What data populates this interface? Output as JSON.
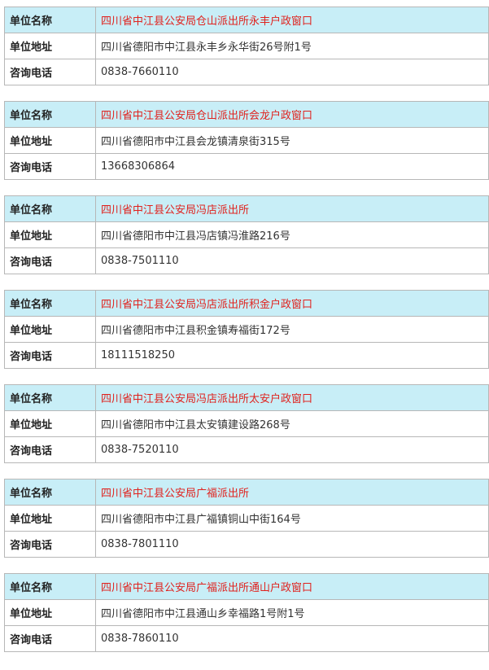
{
  "labels": {
    "name": "单位名称",
    "address": "单位地址",
    "phone": "咨询电话"
  },
  "colors": {
    "header_background": "#c8eef7",
    "name_text": "#e0221e",
    "border": "#b7b7b7"
  },
  "entries": [
    {
      "name": "四川省中江县公安局仓山派出所永丰户政窗口",
      "address": "四川省德阳市中江县永丰乡永华街26号附1号",
      "phone": "0838-7660110"
    },
    {
      "name": "四川省中江县公安局仓山派出所会龙户政窗口",
      "address": "四川省德阳市中江县会龙镇清泉街315号",
      "phone": "13668306864"
    },
    {
      "name": "四川省中江县公安局冯店派出所",
      "address": "四川省德阳市中江县冯店镇冯淮路216号",
      "phone": "0838-7501110"
    },
    {
      "name": "四川省中江县公安局冯店派出所积金户政窗口",
      "address": "四川省德阳市中江县积金镇寿福街172号",
      "phone": "18111518250"
    },
    {
      "name": "四川省中江县公安局冯店派出所太安户政窗口",
      "address": "四川省德阳市中江县太安镇建设路268号",
      "phone": "0838-7520110"
    },
    {
      "name": "四川省中江县公安局广福派出所",
      "address": "四川省德阳市中江县广福镇铜山中街164号",
      "phone": "0838-7801110"
    },
    {
      "name": "四川省中江县公安局广福派出所通山户政窗口",
      "address": "四川省德阳市中江县通山乡幸福路1号附1号",
      "phone": "0838-7860110"
    }
  ]
}
